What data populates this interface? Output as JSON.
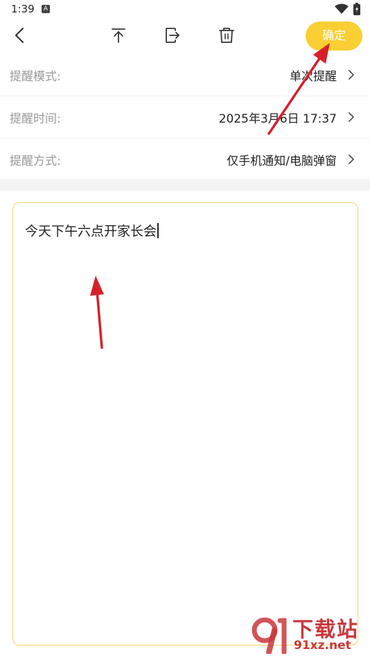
{
  "status_bar": {
    "time": "1:39",
    "app_icon": "A"
  },
  "toolbar": {
    "icons": [
      "back-icon",
      "move-to-top-icon",
      "export-icon",
      "trash-icon"
    ],
    "confirm_label": "确定"
  },
  "settings": [
    {
      "label": "提醒模式:",
      "value": "单次提醒"
    },
    {
      "label": "提醒时间:",
      "value": "2025年3月6日 17:37"
    },
    {
      "label": "提醒方式:",
      "value": "仅手机通知/电脑弹窗"
    }
  ],
  "note": {
    "content": "今天下午六点开家长会"
  },
  "watermark": {
    "title": "下载站",
    "url": "91xz.net"
  },
  "colors": {
    "accent": "#f9cf33",
    "note_border": "#f9d46a",
    "annotation_arrow": "#d8202a",
    "watermark": "#c9373c"
  }
}
